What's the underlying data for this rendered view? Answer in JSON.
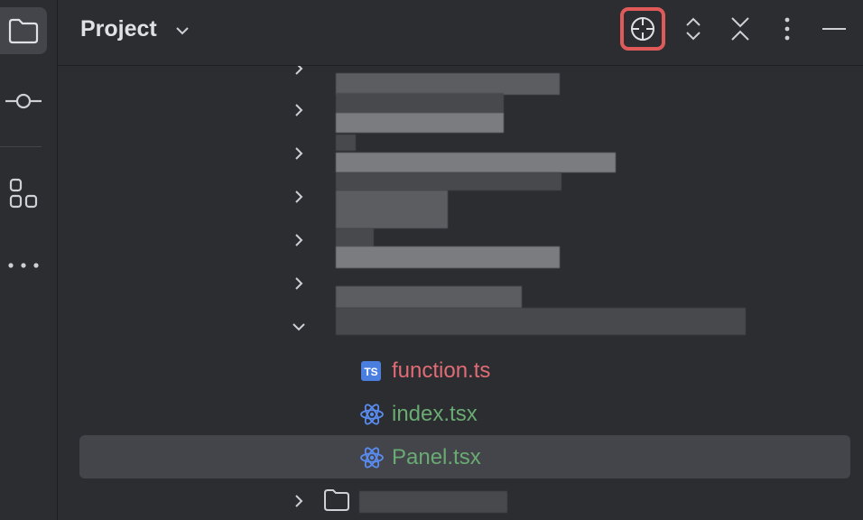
{
  "sidebar": {
    "items": [
      {
        "name": "project",
        "icon": "folder-icon",
        "active": true
      },
      {
        "name": "commit",
        "icon": "commit-icon",
        "active": false
      },
      {
        "name": "structure",
        "icon": "structure-icon",
        "active": false
      },
      {
        "name": "more",
        "icon": "more-horizontal-icon",
        "active": false
      }
    ]
  },
  "header": {
    "title": "Project",
    "buttons": [
      {
        "name": "locate-file",
        "icon": "crosshair-icon"
      },
      {
        "name": "expand-all",
        "icon": "expand-all-icon"
      },
      {
        "name": "collapse-all",
        "icon": "collapse-all-icon"
      },
      {
        "name": "options",
        "icon": "more-vertical-icon"
      },
      {
        "name": "hide",
        "icon": "minimize-icon"
      }
    ]
  },
  "tree": {
    "files": [
      {
        "name": "function.ts",
        "type": "ts",
        "color": "#e06c75"
      },
      {
        "name": "index.tsx",
        "type": "tsx",
        "color": "#6aab73"
      },
      {
        "name": "Panel.tsx",
        "type": "tsx",
        "color": "#6aab73",
        "selected": true
      }
    ]
  },
  "colors": {
    "accent_highlight": "#e05a5a",
    "ts_icon": "#4a7fe0",
    "react_icon": "#5a8cf0"
  }
}
